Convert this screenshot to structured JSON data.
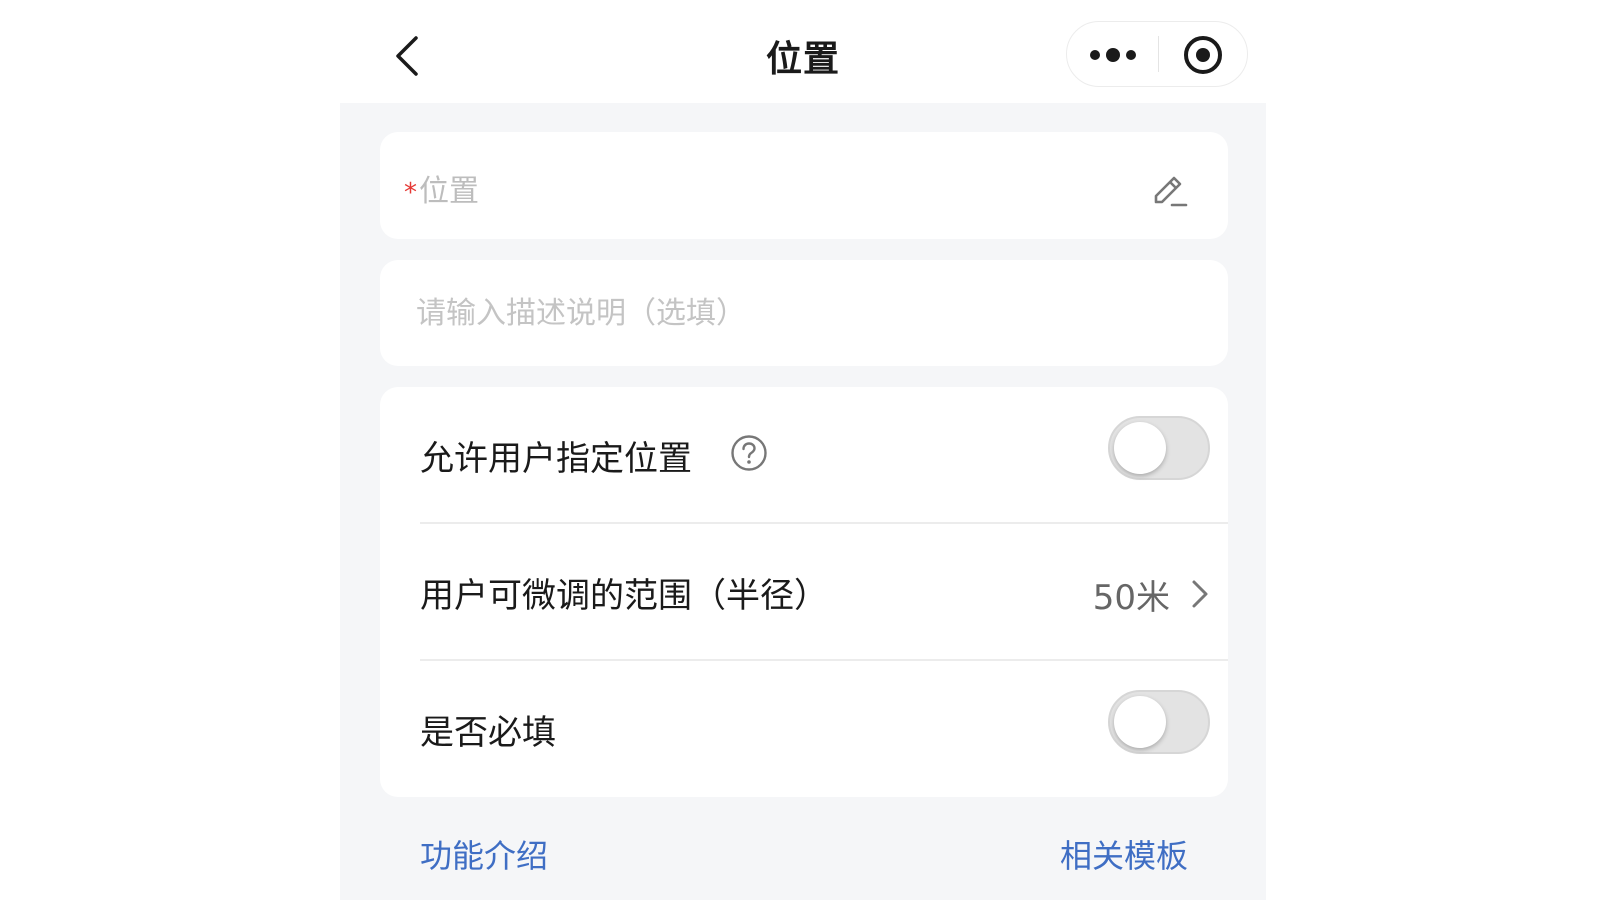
{
  "nav": {
    "title": "位置",
    "back_icon": "chevron-left-icon",
    "more_icon": "more-dots-icon",
    "close_icon": "target-circle-icon"
  },
  "location_field": {
    "required_mark": "*",
    "label": "位置",
    "edit_icon": "pencil-icon"
  },
  "description_field": {
    "value": "",
    "placeholder": "请输入描述说明（选填）"
  },
  "settings": {
    "allow_user_specify": {
      "label": "允许用户指定位置",
      "help_icon": "question-circle-icon",
      "enabled": false
    },
    "adjust_range": {
      "label": "用户可微调的范围（半径）",
      "value": "50米",
      "chevron_icon": "chevron-right-icon"
    },
    "required": {
      "label": "是否必填",
      "enabled": false
    }
  },
  "footer": {
    "intro_link": "功能介绍",
    "templates_link": "相关模板"
  },
  "colors": {
    "page_bg": "#f5f6f8",
    "card_bg": "#ffffff",
    "required_red": "#e53935",
    "link_blue": "#3f6ec4",
    "toggle_off": "#e3e3e3"
  }
}
